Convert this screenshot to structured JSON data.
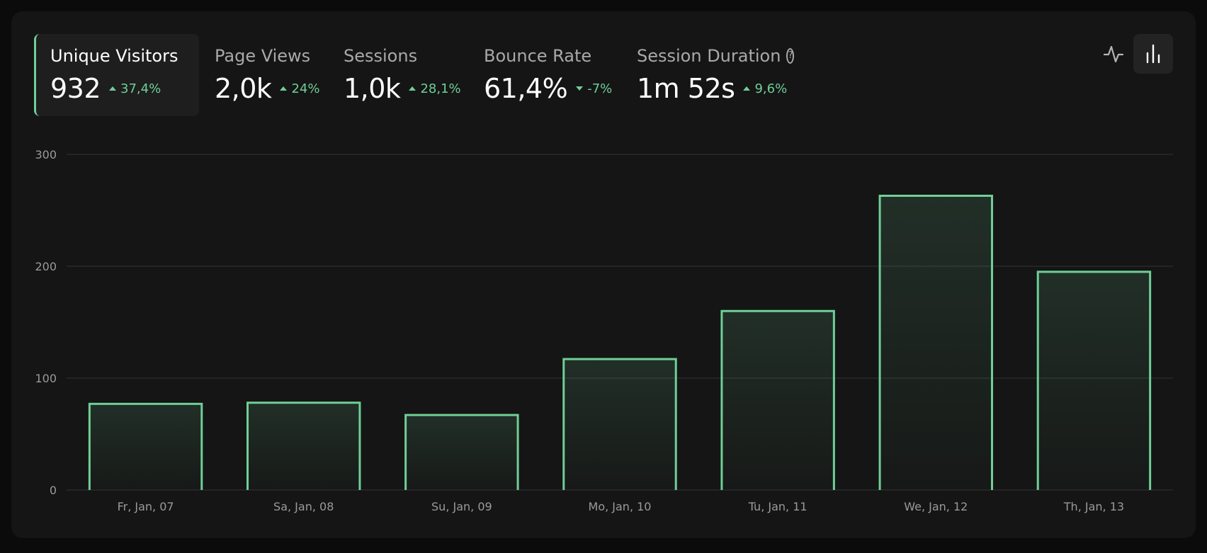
{
  "metrics": [
    {
      "label": "Unique Visitors",
      "value": "932",
      "delta": "37,4%",
      "direction": "up",
      "active": true
    },
    {
      "label": "Page Views",
      "value": "2,0k",
      "delta": "24%",
      "direction": "up",
      "active": false
    },
    {
      "label": "Sessions",
      "value": "1,0k",
      "delta": "28,1%",
      "direction": "up",
      "active": false
    },
    {
      "label": "Bounce Rate",
      "value": "61,4%",
      "delta": "-7%",
      "direction": "down",
      "active": false
    },
    {
      "label": "Session Duration",
      "value": "1m 52s",
      "delta": "9,6%",
      "direction": "up",
      "active": false,
      "help_icon": "question-circle-icon"
    }
  ],
  "toggle": {
    "options": [
      {
        "icon": "line-chart-icon",
        "active": false
      },
      {
        "icon": "bar-chart-icon",
        "active": true
      }
    ]
  },
  "colors": {
    "accent": "#6fcf97",
    "background": "#151515",
    "grid": "#2e2e2e"
  },
  "chart_data": {
    "type": "bar",
    "categories": [
      "Fr, Jan, 07",
      "Sa, Jan, 08",
      "Su, Jan, 09",
      "Mo, Jan, 10",
      "Tu, Jan, 11",
      "We, Jan, 12",
      "Th, Jan, 13"
    ],
    "series": [
      {
        "values": [
          77,
          78,
          67,
          117,
          160,
          263,
          195
        ]
      }
    ],
    "ylim": [
      0,
      300
    ],
    "yticks": [
      0,
      100,
      200,
      300
    ],
    "grid": true,
    "xlabel": "",
    "ylabel": ""
  }
}
